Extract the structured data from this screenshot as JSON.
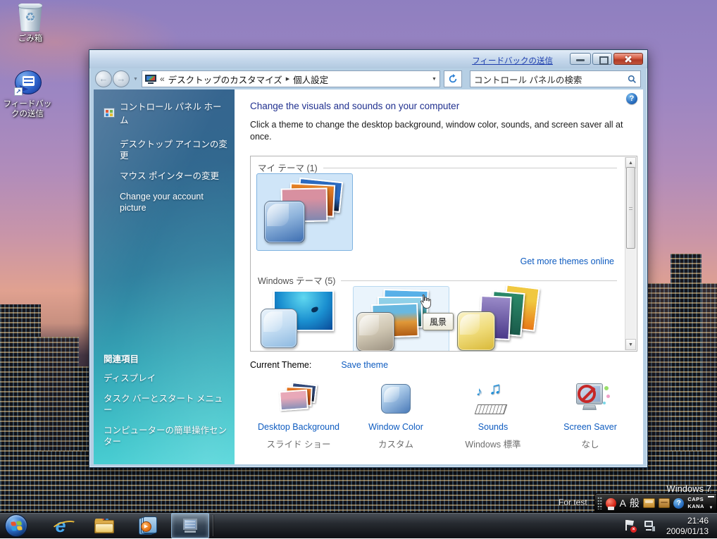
{
  "colors": {
    "link_blue": "#0f5cc0",
    "heading_blue": "#20308f",
    "selection_fill": "#cfe5f8",
    "selection_border": "#7fb2e0",
    "sidebar_top": "#38648f",
    "sidebar_bottom": "#52d6da",
    "taskbar_dark": "#121418",
    "close_red": "#b03a26"
  },
  "glyphs": {
    "back_arrow": "←",
    "forward_arrow": "→",
    "dropdown": "▼",
    "crumb_chevrons": "«",
    "crumb_sep": "▶",
    "scroll_up": "▲",
    "scroll_down": "▼",
    "recycle": "♻",
    "note1": "♪",
    "note2": "♫",
    "help": "?",
    "refresh": "↻",
    "play": "▶",
    "error_x": "×"
  },
  "desktop": {
    "icons": [
      {
        "label": "ごみ箱"
      },
      {
        "label": "フィードバックの送信"
      }
    ],
    "watermark_title": "Windows 7",
    "watermark_note": "For test"
  },
  "window": {
    "titlebar": {
      "feedback_link": "フィードバックの送信"
    },
    "address": {
      "crumb1": "デスクトップのカスタマイズ",
      "crumb2": "個人設定",
      "search_placeholder": "コントロール パネルの検索"
    },
    "sidebar": {
      "home": "コントロール パネル ホーム",
      "links": [
        "デスクトップ アイコンの変更",
        "マウス ポインターの変更",
        "Change your account picture"
      ],
      "related_header": "関連項目",
      "related_links": [
        "ディスプレイ",
        "タスク バーとスタート メニュー",
        "コンピューターの簡単操作センター"
      ]
    },
    "main": {
      "heading": "Change the visuals and sounds on your computer",
      "description": "Click a theme to change the desktop background, window color, sounds, and screen saver all at once.",
      "my_themes_header": "マイ テーマ (1)",
      "get_more_link": "Get more themes online",
      "windows_themes_header": "Windows テーマ (5)",
      "hover_tooltip": "風景",
      "current_theme_label": "Current Theme:",
      "save_theme_link": "Save theme",
      "settings": [
        {
          "label": "Desktop Background",
          "value": "スライド ショー"
        },
        {
          "label": "Window Color",
          "value": "カスタム"
        },
        {
          "label": "Sounds",
          "value": "Windows 標準"
        },
        {
          "label": "Screen Saver",
          "value": "なし"
        }
      ]
    }
  },
  "language_bar": {
    "ime_mode": "A",
    "ime_conv": "般",
    "caps": "CAPS",
    "kana": "KANA"
  },
  "tray": {
    "time": "21:46",
    "date": "2009/01/13"
  }
}
